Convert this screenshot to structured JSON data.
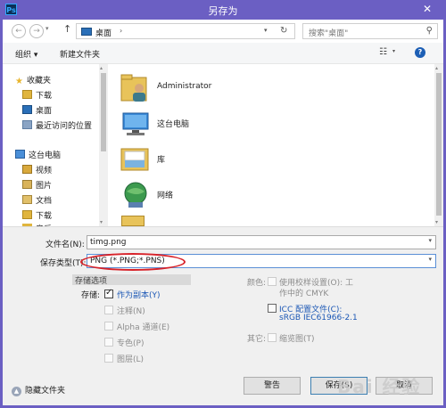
{
  "titlebar": {
    "app_icon": "Ps",
    "title": "另存为",
    "close": "✕"
  },
  "address": {
    "back": "←",
    "forward": "→",
    "up": "↑",
    "location": "桌面",
    "search_placeholder": "搜索\"桌面\""
  },
  "toolbar": {
    "organize": "组织 ▾",
    "new_folder": "新建文件夹"
  },
  "nav": {
    "items": [
      {
        "label": "收藏夹",
        "icon": "star-icon"
      },
      {
        "label": "下载",
        "icon": "download-folder-icon"
      },
      {
        "label": "桌面",
        "icon": "desktop-icon"
      },
      {
        "label": "最近访问的位置",
        "icon": "recent-places-icon"
      },
      {
        "label": "这台电脑",
        "icon": "computer-icon"
      },
      {
        "label": "视频",
        "icon": "video-folder-icon"
      },
      {
        "label": "图片",
        "icon": "pictures-folder-icon"
      },
      {
        "label": "文档",
        "icon": "documents-folder-icon"
      },
      {
        "label": "下载",
        "icon": "download-folder-icon"
      },
      {
        "label": "音乐",
        "icon": "music-folder-icon"
      }
    ]
  },
  "files": [
    {
      "name": "Administrator",
      "icon": "user-folder-icon"
    },
    {
      "name": "这台电脑",
      "icon": "computer-icon"
    },
    {
      "name": "库",
      "icon": "library-icon"
    },
    {
      "name": "网络",
      "icon": "network-icon"
    }
  ],
  "form": {
    "filename_label": "文件名(N):",
    "filename_value": "timg.png",
    "savetype_label": "保存类型(T):",
    "savetype_value": "PNG (*.PNG;*.PNS)"
  },
  "options": {
    "header": "存储选项",
    "store_label": "存储:",
    "as_copy": "作为副本(Y)",
    "notes": "注释(N)",
    "alpha": "Alpha 通道(E)",
    "spot": "专色(P)",
    "layers": "图层(L)",
    "color_label": "颜色:",
    "use_proof": "使用校样设置(O): 工",
    "proof_line2": "作中的 CMYK",
    "icc": "ICC 配置文件(C):",
    "icc_line2": "sRGB IEC61966-2.1",
    "other_label": "其它:",
    "thumbnail": "缩览图(T)"
  },
  "footer": {
    "hide_folders": "隐藏文件夹",
    "warning_button": "警告",
    "save_button": "保存(S)",
    "cancel_button": "取消"
  },
  "watermark": "Bai 经验"
}
